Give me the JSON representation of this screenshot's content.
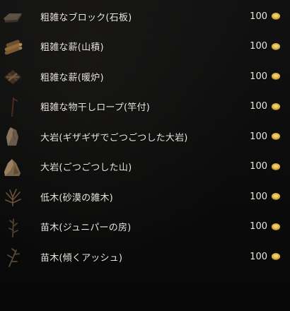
{
  "items": [
    {
      "name": "粗雑なブロック(石板)",
      "price": "100",
      "icon": "stone-slab-icon"
    },
    {
      "name": "粗雑な薪(山積)",
      "price": "100",
      "icon": "firewood-pile-icon"
    },
    {
      "name": "粗雑な薪(暖炉)",
      "price": "100",
      "icon": "fireplace-wood-icon"
    },
    {
      "name": "粗雑な物干しロープ(竿付)",
      "price": "100",
      "icon": "clothesline-pole-icon"
    },
    {
      "name": "大岩(ギザギザでごつごつした大岩)",
      "price": "100",
      "icon": "jagged-boulder-icon"
    },
    {
      "name": "大岩(ごつごつした山)",
      "price": "100",
      "icon": "rocky-mound-icon"
    },
    {
      "name": "低木(砂漠の雑木)",
      "price": "100",
      "icon": "desert-shrub-icon"
    },
    {
      "name": "苗木(ジュニパーの房)",
      "price": "100",
      "icon": "juniper-sapling-icon"
    },
    {
      "name": "苗木(傾くアッシュ)",
      "price": "100",
      "icon": "leaning-ash-sapling-icon"
    }
  ],
  "colors": {
    "background": "#0a0a0a",
    "text": "#ece8df",
    "coin": "#c9a23a"
  }
}
